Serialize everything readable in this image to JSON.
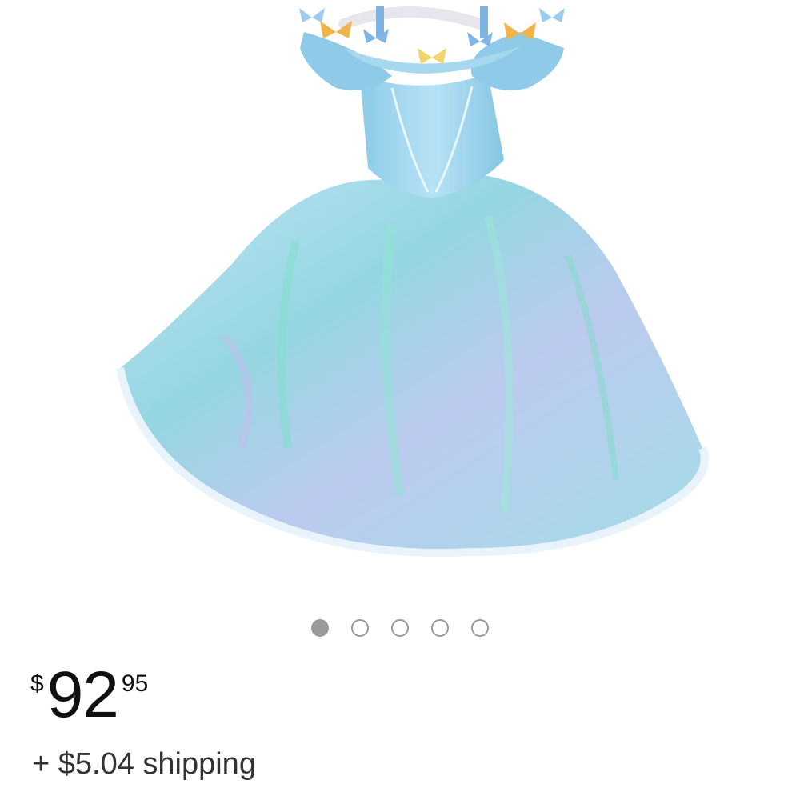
{
  "product": {
    "image_icon": "princess-dress-image",
    "image_count": 5,
    "active_image_index": 0
  },
  "price": {
    "currency_symbol": "$",
    "whole": "92",
    "fraction": "95"
  },
  "shipping": {
    "text": "+ $5.04 shipping"
  },
  "colors": {
    "dress": "#9fd3ec",
    "dot_active": "#9a9a9a",
    "dot_inactive_border": "#9a9a9a",
    "text": "#111111"
  }
}
